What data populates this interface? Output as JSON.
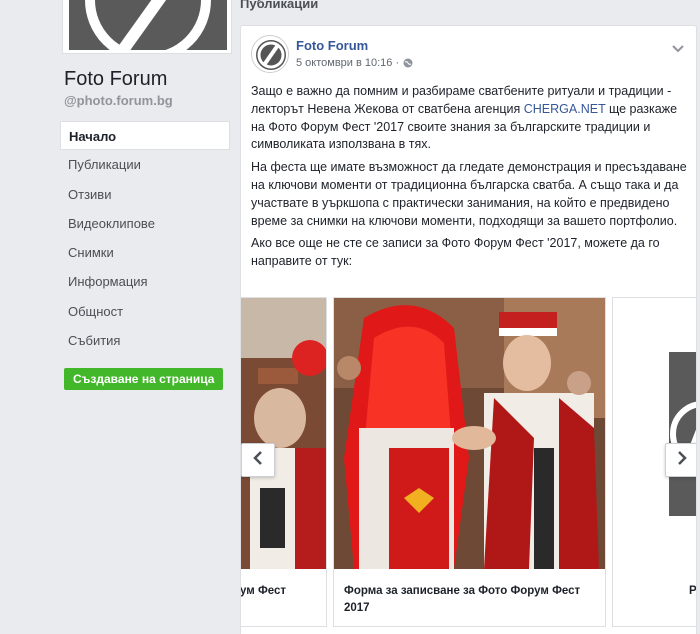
{
  "page": {
    "name": "Foto Forum",
    "handle": "@photo.forum.bg"
  },
  "nav": {
    "items": [
      {
        "label": "Начало",
        "active": true
      },
      {
        "label": "Публикации"
      },
      {
        "label": "Отзиви"
      },
      {
        "label": "Видеоклипове"
      },
      {
        "label": "Снимки"
      },
      {
        "label": "Информация"
      },
      {
        "label": "Общност"
      },
      {
        "label": "Събития"
      }
    ],
    "create_page_label": "Създаване на страница"
  },
  "section": {
    "title": "Публикации"
  },
  "post": {
    "author": "Foto Forum",
    "timestamp": "5 октомври в 10:16 ·",
    "paragraph1_a": "Защо е важно да помним и разбираме сватбените ритуали и традиции - лекторът Невена Жекова от сватбена агенция ",
    "link": "CHERGA.NET",
    "paragraph1_b": " ще разкаже на Фото Форум Фест '2017 своите знания за българските традиции и символиката използвана в тях.",
    "paragraph2": "На феста ще имате възможност да гледате демонстрация и пресъздаване на ключови моменти от традиционна българска сватба. А също така и да участвате в уъркшопа с практически занимания, на който е предвидено време за снимки на ключови моменти, подходящи за вашето портфолио.",
    "paragraph3": "Ако все още не сте се записи за Фото Форум Фест '2017, можете да го направите от тук:"
  },
  "carousel": {
    "left_caption": "ум Фест",
    "main_caption": "Форма за записване за Фото Форум Фест 2017",
    "right_caption": "P"
  },
  "colors": {
    "accent": "#365899",
    "green": "#42b72a",
    "background": "#e9ebee"
  }
}
